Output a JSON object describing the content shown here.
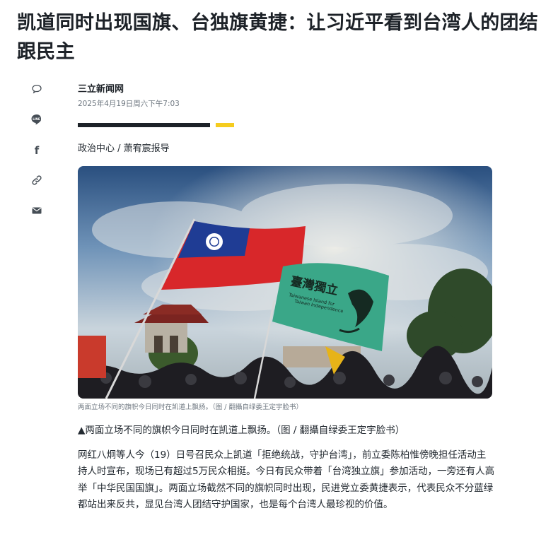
{
  "article": {
    "headline": "凯道同时出现国旗、台独旗黄捷：让习近平看到台湾人的团结跟民主",
    "provider": "三立新闻网",
    "timestamp": "2025年4月19日周六下午7:03",
    "department": "政治中心 / 萧宥宸报导",
    "image_caption_small": "两面立场不同的旗帜今日同时在凯道上飘扬。（图 / 翻攝自绿委王定宇脸书）",
    "image_caption_main": "▲两面立场不同的旗帜今日同时在凯道上飘扬。（图 / 翻攝自绿委王定宇脸书）",
    "body_paragraph": "网红八炯等人今（19）日号召民众上凯道「拒绝统战，守护台湾」，前立委陈柏惟傍晚担任活动主持人时宣布，现场已有超过5万民众相挺。今日有民众带着「台湾独立旗」参加活动，一旁还有人高举「中华民国国旗」。两面立场截然不同的旗帜同时出现，民进党立委黄捷表示，代表民众不分蓝绿都站出来反共，显见台湾人团结守护国家，也是每个台湾人最珍视的价值。"
  },
  "share_buttons": [
    {
      "icon": "comment-icon"
    },
    {
      "icon": "line-icon",
      "label": "LINE"
    },
    {
      "icon": "facebook-icon",
      "label": "f"
    },
    {
      "icon": "link-icon"
    },
    {
      "icon": "mail-icon"
    }
  ],
  "photo_text": {
    "flag_text_line1": "臺灣獨立",
    "flag_text_line2": "Taiwanese Island for",
    "flag_text_line3": "Taiwan Independence"
  },
  "colors": {
    "divider_dark": "#1d2228",
    "divider_accent": "#f5cc1f",
    "roc_red": "#d8272a",
    "roc_blue": "#1f3c94",
    "independence_green": "#3aa788"
  }
}
